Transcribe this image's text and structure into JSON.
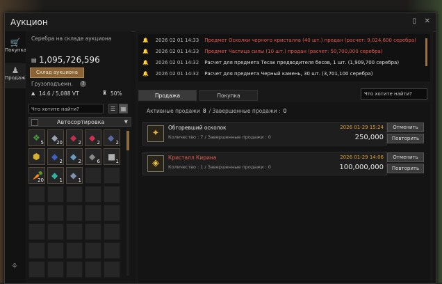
{
  "window": {
    "title": "Аукцион"
  },
  "nav": [
    {
      "label": "Покупка",
      "icon": "cart-icon"
    },
    {
      "label": "Продажа",
      "icon": "character-icon"
    }
  ],
  "left": {
    "silver_label": "Серебра на складе аукциона",
    "silver_amount": "1,095,726,596",
    "store_button": "Склад аукциона",
    "cargo_label": "Грузоподъемн.",
    "weight": "14.6 / 5,088 VT",
    "weight_pct": "50%",
    "search_placeholder": "Что хотите найти?",
    "sort_label": "Автосортировка"
  },
  "inventory": [
    {
      "glyph": "❖",
      "color": "#4a9a3a",
      "count": "5"
    },
    {
      "glyph": "◆",
      "color": "#9aa0b0",
      "count": "20"
    },
    {
      "glyph": "◆",
      "color": "#c0304a",
      "count": "2"
    },
    {
      "glyph": "◆",
      "color": "#d03050",
      "count": "2"
    },
    {
      "glyph": "◆",
      "color": "#5a6aa0",
      "count": "2"
    },
    {
      "glyph": "⬢",
      "color": "#d6b030",
      "count": ""
    },
    {
      "glyph": "◆",
      "color": "#4060c0",
      "count": "2"
    },
    {
      "glyph": "◆",
      "color": "#6a9ac0",
      "count": "2"
    },
    {
      "glyph": "◆",
      "color": "#8a8a8a",
      "count": "6"
    },
    {
      "glyph": "■",
      "color": "#b0b0b0",
      "count": "1"
    },
    {
      "glyph": "🥕",
      "color": "#e07020",
      "count": "20"
    },
    {
      "glyph": "◆",
      "color": "#30b0a0",
      "count": "1"
    },
    {
      "glyph": "◆",
      "color": "#8090b0",
      "count": "1"
    }
  ],
  "log": [
    {
      "time": "2026 02 01 14:33",
      "text": "Предмет Осколки черного кристалла (40 шт.) продан (расчет: 9,024,600 серебра)",
      "tone": "red"
    },
    {
      "time": "2026 02 01 14:33",
      "text": "Предмет Частица силы (10 шт.) продан (расчет: 50,700,000 серебра)",
      "tone": "red"
    },
    {
      "time": "2026 02 01 14:32",
      "text": "Расчет для предмета Тесак предводителя бесов, 1 шт. (1,909,700 серебра)",
      "tone": "white"
    },
    {
      "time": "2026 02 01 14:32",
      "text": "Расчет для предмета Черный камень, 30 шт. (3,701,100 серебра)",
      "tone": "white"
    }
  ],
  "tabs": {
    "sell": "Продажа",
    "buy": "Покупка"
  },
  "right_search_placeholder": "Что хотите найти?",
  "stats": {
    "active_label": "Активные продажи",
    "active_count": "8",
    "done_label": "/ Завершенные продажи :",
    "done_count": "0"
  },
  "listings": [
    {
      "name": "Обгоревший осколок",
      "name_color": "#e8e8e8",
      "qty": "Количество : 7 / Завершенные продажи : 0",
      "date": "2026 01-29 15:24",
      "price": "250,000",
      "cancel": "Отменить",
      "repeat": "Повторить",
      "icon": "shard-icon"
    },
    {
      "name": "Кристалл Кирина",
      "name_color": "#e06050",
      "qty": "Количество : 1 / Завершенные продажи : 0",
      "date": "2026 01-29 14:06",
      "price": "100,000,000",
      "cancel": "Отменить",
      "repeat": "Повторить",
      "icon": "crystal-icon"
    }
  ]
}
